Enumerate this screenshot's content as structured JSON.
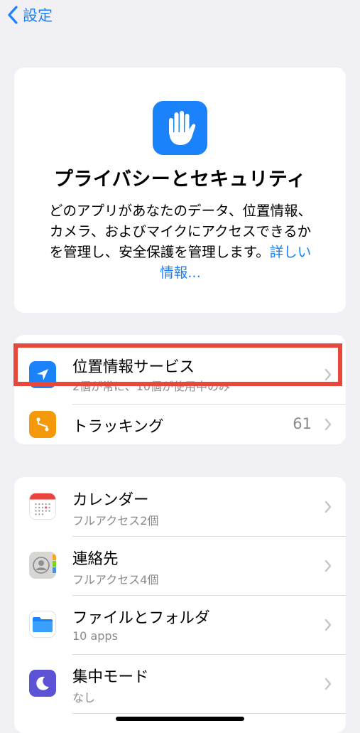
{
  "nav": {
    "back_label": "設定"
  },
  "header": {
    "title": "プライバシーとセキュリティ",
    "description": "どのアプリがあなたのデータ、位置情報、カメラ、およびマイクにアクセスできるかを管理し、安全保護を管理します。",
    "learn_more": "詳しい情報..."
  },
  "group1": {
    "location": {
      "title": "位置情報サービス",
      "subtitle": "2個が常に、10個が使用中のみ"
    },
    "tracking": {
      "title": "トラッキング",
      "value": "61"
    }
  },
  "group2": {
    "items": [
      {
        "title": "カレンダー",
        "subtitle": "フルアクセス2個",
        "icon": "calendar-icon"
      },
      {
        "title": "連絡先",
        "subtitle": "フルアクセス4個",
        "icon": "contacts-icon"
      },
      {
        "title": "ファイルとフォルダ",
        "subtitle": "10 apps",
        "icon": "folder-icon"
      },
      {
        "title": "集中モード",
        "subtitle": "なし",
        "icon": "moon-icon"
      }
    ]
  },
  "colors": {
    "accent": "#1a82fb",
    "background": "#f1f0f5",
    "highlight": "#e8473c",
    "tracking_icon": "#f49a0a",
    "focus_icon": "#5b52d6"
  }
}
